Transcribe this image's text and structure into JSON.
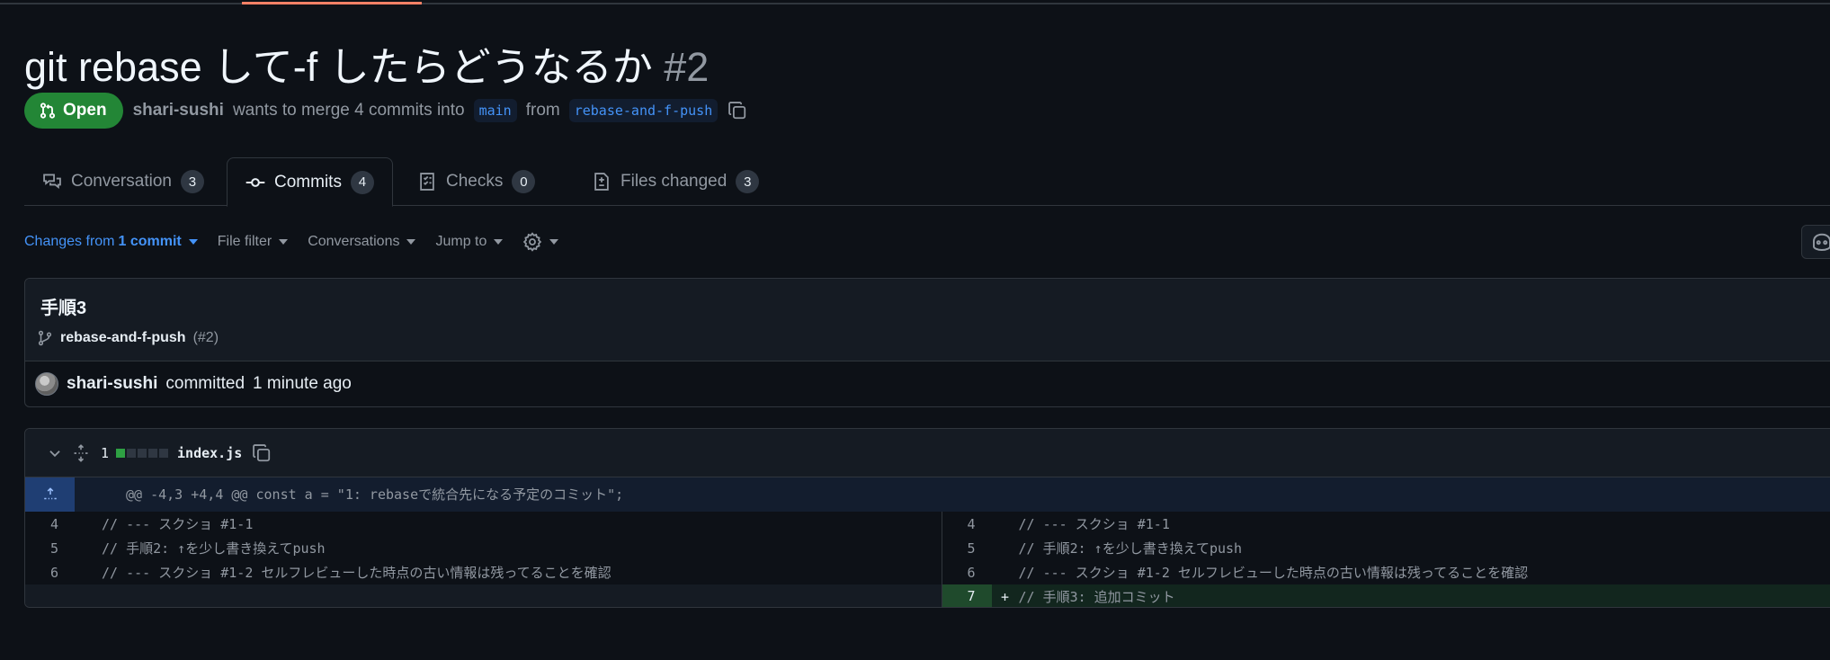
{
  "pr": {
    "title": "git rebase して-f したらどうなるか",
    "number": "#2",
    "state": "Open",
    "author": "shari-sushi",
    "merge_text": "wants to merge 4 commits into",
    "base_branch": "main",
    "from_text": "from",
    "head_branch": "rebase-and-f-push"
  },
  "tabs": [
    {
      "label": "Conversation",
      "count": "3",
      "icon": "conversation-icon"
    },
    {
      "label": "Commits",
      "count": "4",
      "icon": "commit-icon"
    },
    {
      "label": "Checks",
      "count": "0",
      "icon": "checks-icon"
    },
    {
      "label": "Files changed",
      "count": "3",
      "icon": "file-diff-icon"
    }
  ],
  "toolbar": {
    "changes_prefix": "Changes from",
    "changes_value": "1 commit",
    "file_filter": "File filter",
    "conversations": "Conversations",
    "jump_to": "Jump to"
  },
  "commit": {
    "title": "手順3",
    "branch": "rebase-and-f-push",
    "pr_ref": "(#2)",
    "author": "shari-sushi",
    "committed_text": "committed",
    "time": "1 minute ago"
  },
  "file": {
    "change_count": "1",
    "name": "index.js",
    "diffstat": {
      "added_blocks": 1,
      "neutral_blocks": 4
    },
    "hunk_header": "@@ -4,3 +4,4 @@ const a = \"1: rebaseで統合先になる予定のコミット\";",
    "left": [
      {
        "ln": "4",
        "code": "//   --- スクショ #1-1"
      },
      {
        "ln": "5",
        "code": "// 手順2: ↑を少し書き換えてpush"
      },
      {
        "ln": "6",
        "code": "//   --- スクショ #1-2 セルフレビューした時点の古い情報は残ってることを確認"
      }
    ],
    "right": [
      {
        "ln": "4",
        "code": "//   --- スクショ #1-1"
      },
      {
        "ln": "5",
        "code": "// 手順2: ↑を少し書き換えてpush"
      },
      {
        "ln": "6",
        "code": "//   --- スクショ #1-2 セルフレビューした時点の古い情報は残ってることを確認"
      }
    ],
    "added": {
      "ln": "7",
      "marker": "+",
      "code": "// 手順3: 追加コミット"
    }
  },
  "colors": {
    "background": "#0d1117",
    "open_badge": "#238636",
    "link": "#4493f8",
    "added_line": "#1f4a2c",
    "active_tab_accent": "#f78166"
  }
}
